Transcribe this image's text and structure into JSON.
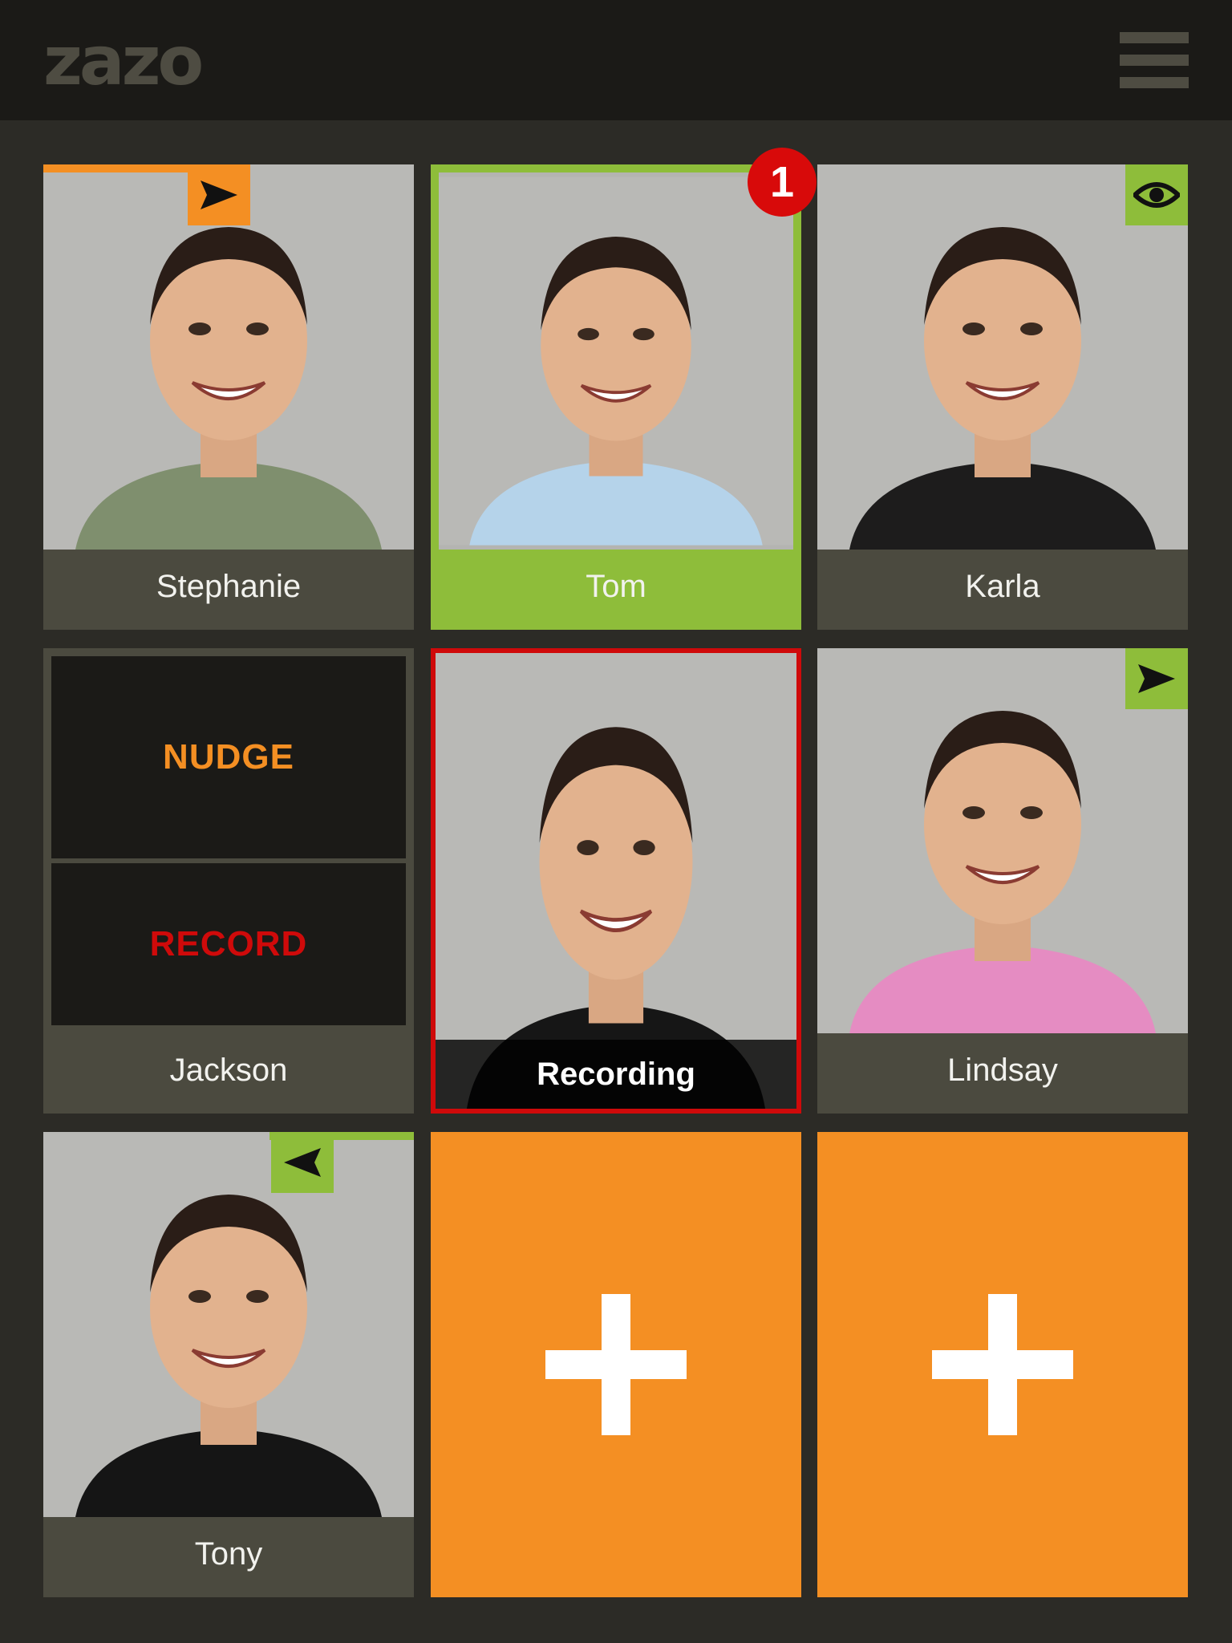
{
  "header": {
    "logo": "zazo",
    "menu_icon": "hamburger-menu-icon"
  },
  "tiles": {
    "stephanie": {
      "name": "Stephanie",
      "status_icon": "send-icon",
      "status_color": "#f48f23"
    },
    "tom": {
      "name": "Tom",
      "unread_count": "1",
      "highlight_color": "#8ebd3a"
    },
    "karla": {
      "name": "Karla",
      "status_icon": "eye-icon",
      "status_color": "#8ebd3a"
    },
    "jackson": {
      "name": "Jackson",
      "nudge_label": "NUDGE",
      "record_label": "RECORD",
      "nudge_color": "#f48f23",
      "record_color": "#cf0a0a"
    },
    "recording": {
      "label": "Recording",
      "border_color": "#cf0a0a"
    },
    "lindsay": {
      "name": "Lindsay",
      "status_icon": "send-icon",
      "status_color": "#8ebd3a"
    },
    "tony": {
      "name": "Tony",
      "status_icon": "received-icon",
      "status_color": "#8ebd3a"
    },
    "add_friend_tiles": [
      {
        "icon": "plus-icon"
      },
      {
        "icon": "plus-icon"
      }
    ]
  },
  "colors": {
    "background": "#2c2b26",
    "header": "#1b1a17",
    "orange": "#f48f23",
    "green": "#8ebd3a",
    "red": "#cf0a0a"
  }
}
